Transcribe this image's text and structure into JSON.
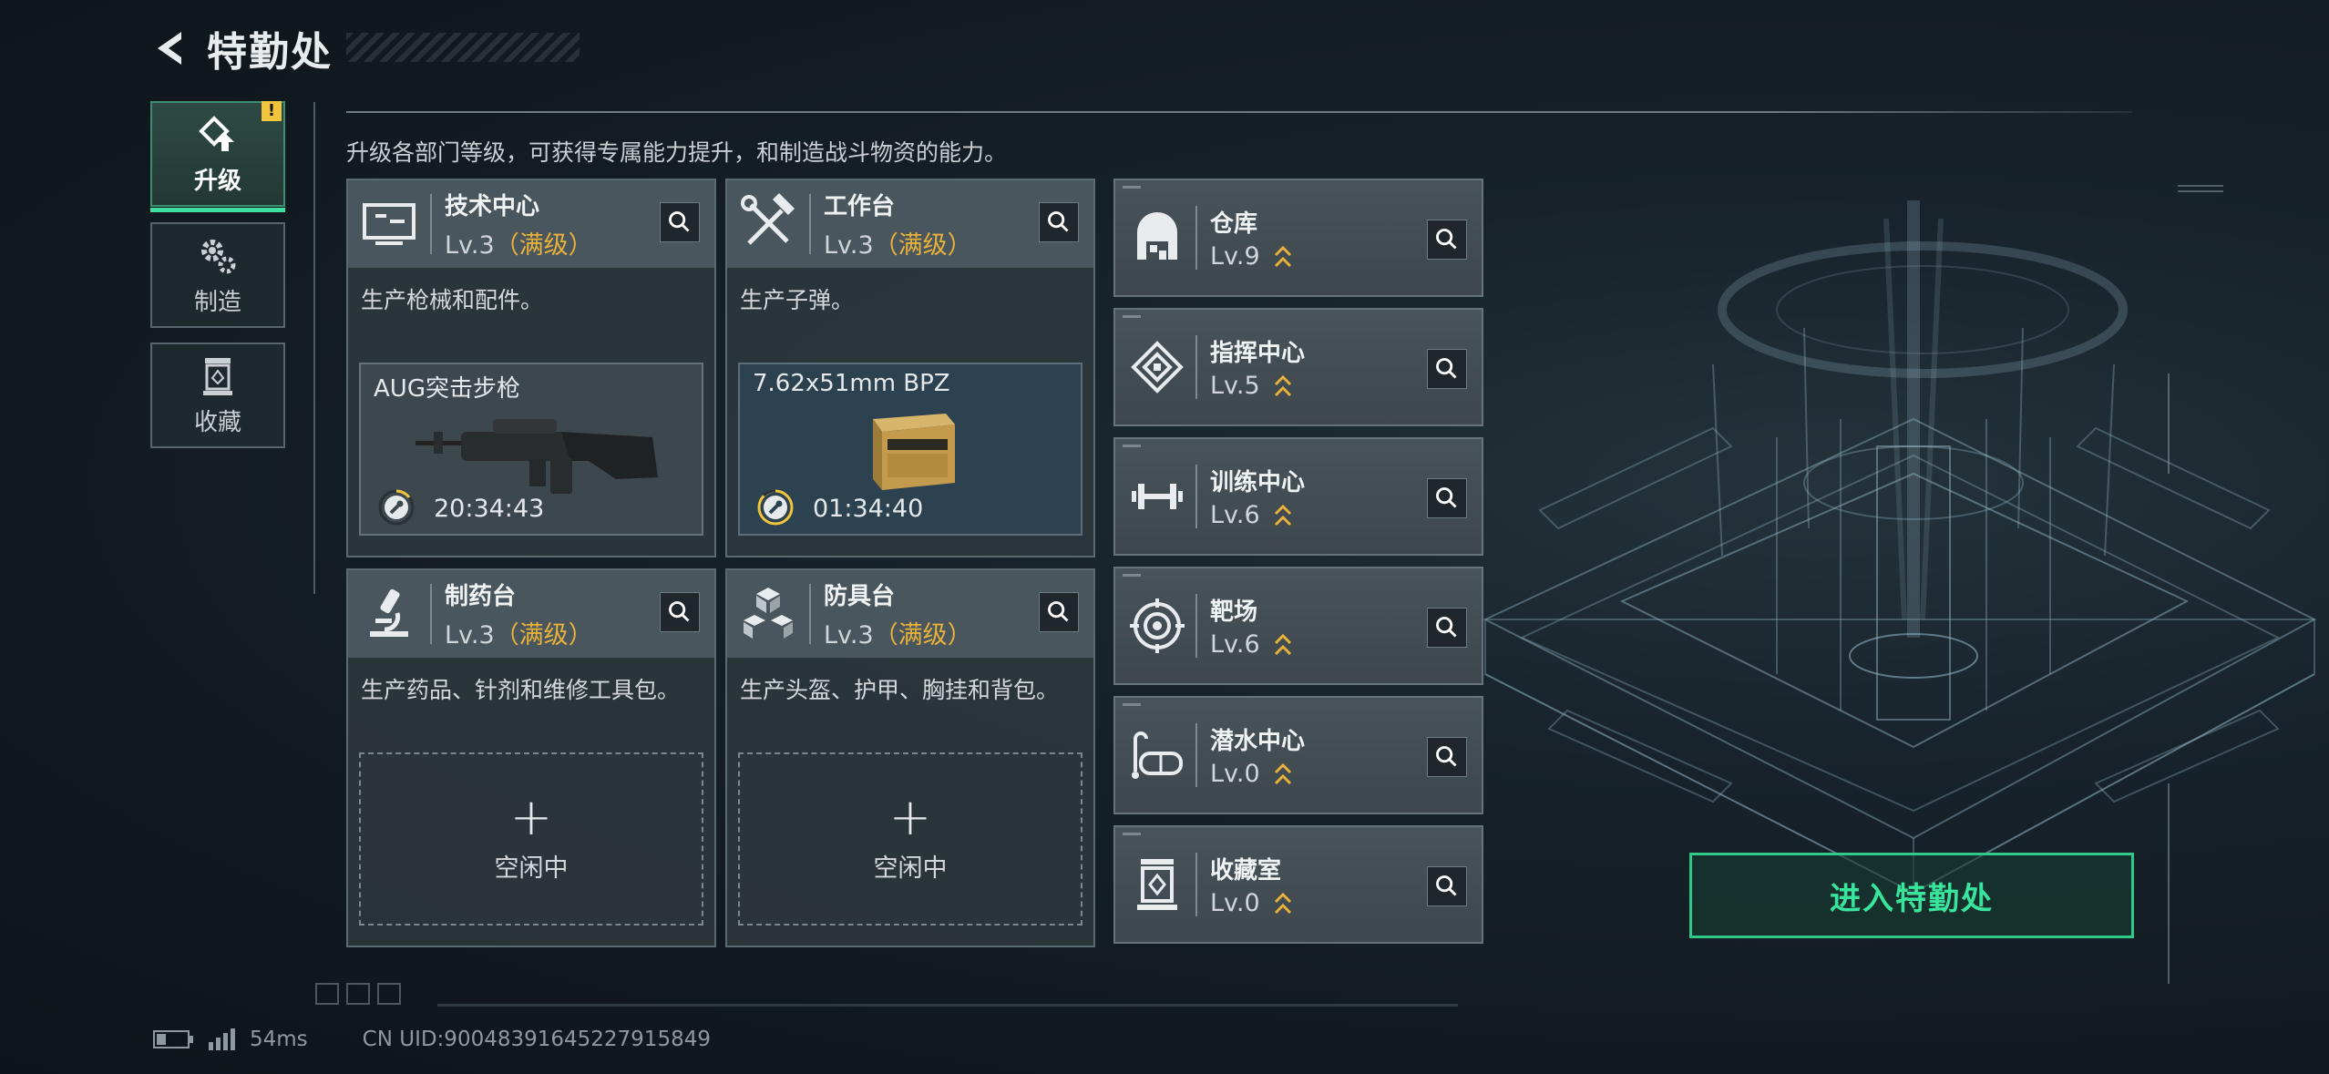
{
  "header": {
    "title": "特勤处"
  },
  "nav": {
    "tabs": [
      {
        "label": "升级",
        "icon": "upgrade-icon",
        "active": true,
        "alert": "!"
      },
      {
        "label": "制造",
        "icon": "gears-icon",
        "active": false
      },
      {
        "label": "收藏",
        "icon": "collection-icon",
        "active": false
      }
    ]
  },
  "description": "升级各部门等级，可获得专属能力提升，和制造战斗物资的能力。",
  "cards": [
    {
      "name": "技术中心",
      "level": "Lv.3",
      "maxed": "（满级）",
      "desc": "生产枪械和配件。",
      "production": {
        "item": "AUG突击步枪",
        "timer": "20:34:43",
        "progress": 0.15
      }
    },
    {
      "name": "工作台",
      "level": "Lv.3",
      "maxed": "（满级）",
      "desc": "生产子弹。",
      "production": {
        "item": "7.62x51mm BPZ",
        "timer": "01:34:40",
        "progress": 0.85
      }
    },
    {
      "name": "制药台",
      "level": "Lv.3",
      "maxed": "（满级）",
      "desc": "生产药品、针剂和维修工具包。",
      "idle": {
        "plus": "+",
        "label": "空闲中"
      }
    },
    {
      "name": "防具台",
      "level": "Lv.3",
      "maxed": "（满级）",
      "desc": "生产头盔、护甲、胸挂和背包。",
      "idle": {
        "plus": "+",
        "label": "空闲中"
      }
    }
  ],
  "departments": [
    {
      "name": "仓库",
      "level": "Lv.9",
      "icon": "warehouse-icon"
    },
    {
      "name": "指挥中心",
      "level": "Lv.5",
      "icon": "command-center-icon"
    },
    {
      "name": "训练中心",
      "level": "Lv.6",
      "icon": "dumbbell-icon"
    },
    {
      "name": "靶场",
      "level": "Lv.6",
      "icon": "target-icon"
    },
    {
      "name": "潜水中心",
      "level": "Lv.0",
      "icon": "diving-mask-icon"
    },
    {
      "name": "收藏室",
      "level": "Lv.0",
      "icon": "collection-room-icon"
    }
  ],
  "enter_button": "进入特勤处",
  "footer": {
    "ping": "54ms",
    "uid": "CN UID:9004839164522791584​9"
  },
  "colors": {
    "accent_green": "#39e59d",
    "maxed_gold": "#e8b23a",
    "alert_yellow": "#f0c43c"
  }
}
